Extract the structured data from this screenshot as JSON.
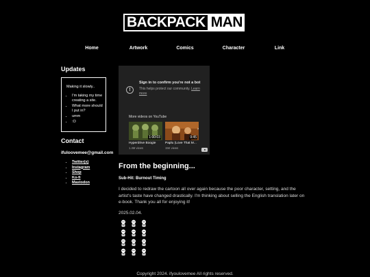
{
  "logo": {
    "part1": "BACKPACK",
    "part2": "MAN"
  },
  "nav": [
    {
      "label": "Home"
    },
    {
      "label": "Artwork"
    },
    {
      "label": "Comics"
    },
    {
      "label": "Character"
    },
    {
      "label": "Link"
    }
  ],
  "sidebar": {
    "updates_heading": "Updates",
    "updates_intro": "Making it slowly..",
    "updates_items": [
      "I'm taking my time creating a site.",
      "What more should I put in?",
      "umm",
      ":O"
    ],
    "contact_heading": "Contact",
    "email": "ifuloovemee@gmail.com",
    "links": [
      "Twitter(x)",
      "Instagram",
      "Shop",
      "Ko-fi",
      "Mastodon"
    ]
  },
  "video": {
    "title": "Sign in to confirm you're not a bot",
    "desc": "This helps protect our community.",
    "learn_more": "Learn more",
    "more_videos": "More videos on YouTube",
    "items": [
      {
        "title": "Hyperdrive Boogie",
        "views": "1.4M views",
        "duration": "1:00:03"
      },
      {
        "title": "Paplu (Love That M...",
        "views": "15K views",
        "duration": "9:45"
      }
    ]
  },
  "post": {
    "title": "From the beginning...",
    "subtitle": "Sub-Hit: Burnout Timing",
    "body": "I decided to redraw the cartoon all over again because the poor character, setting, and the artist's taste have changed drastically. I'm thinking about selling the English translation later on e-book. Thank you all for enjoying it!",
    "date": "2025.02.04."
  },
  "footer": "Copyright 2024. ifyoulovemee All rights reserved."
}
